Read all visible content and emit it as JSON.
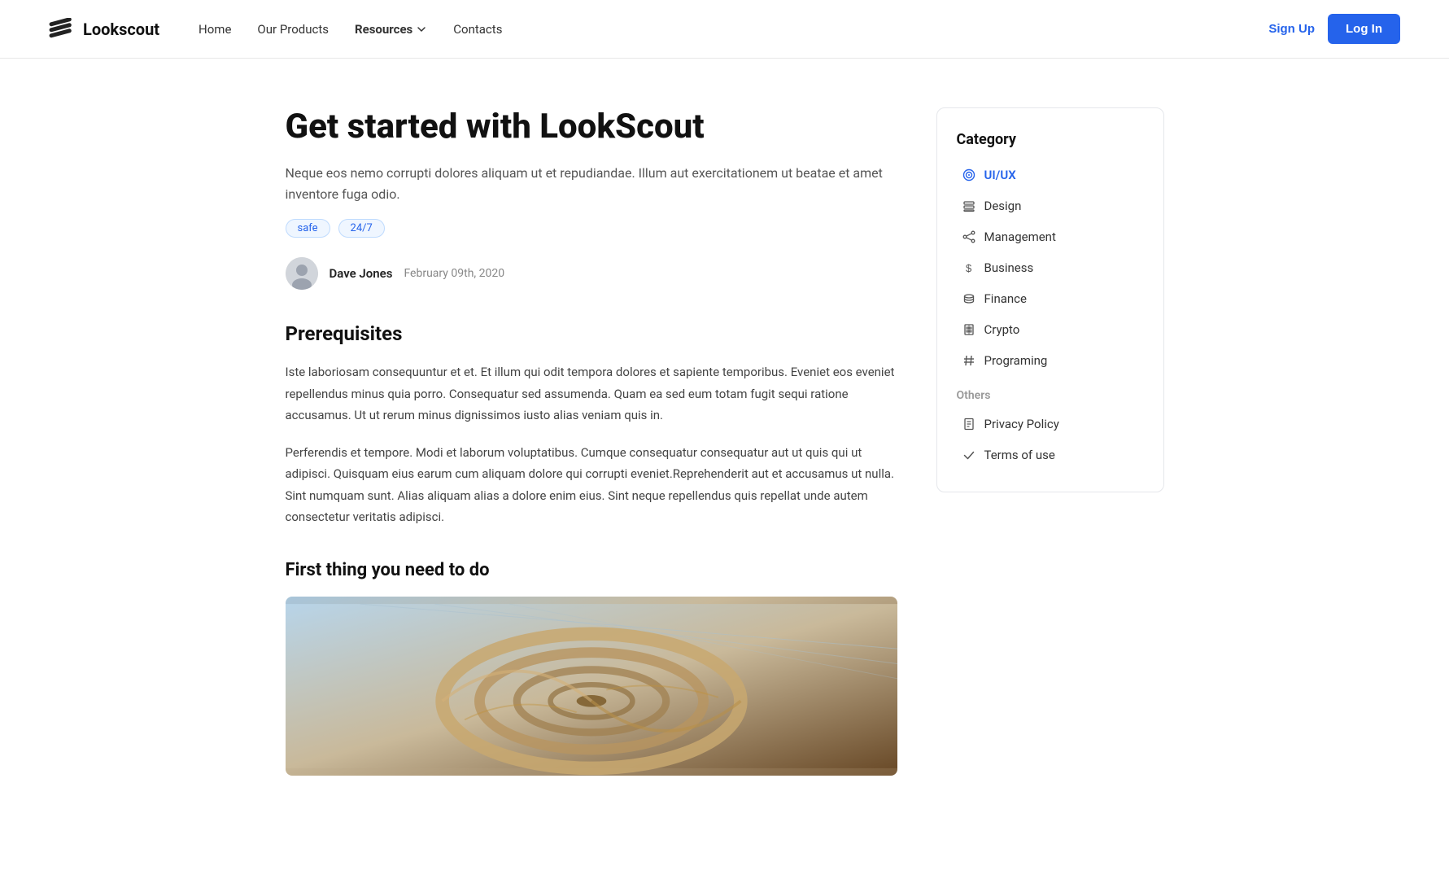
{
  "nav": {
    "logo_text": "Lookscout",
    "links": [
      {
        "label": "Home",
        "active": false
      },
      {
        "label": "Our Products",
        "active": false
      },
      {
        "label": "Resources",
        "active": true,
        "has_dropdown": true
      },
      {
        "label": "Contacts",
        "active": false
      }
    ],
    "signup_label": "Sign Up",
    "login_label": "Log In"
  },
  "article": {
    "title": "Get started with LookScout",
    "subtitle": "Neque eos nemo corrupti dolores aliquam ut et repudiandae. Illum aut exercitationem ut beatae et amet inventore fuga odio.",
    "tags": [
      "safe",
      "24/7"
    ],
    "author_name": "Dave Jones",
    "date": "February 09th, 2020",
    "prerequisites_heading": "Prerequisites",
    "prerequisites_body1": "Iste laboriosam consequuntur et et. Et illum qui odit tempora dolores et sapiente temporibus. Eveniet eos eveniet repellendus minus quia porro. Consequatur sed assumenda. Quam ea sed eum totam fugit sequi ratione accusamus. Ut ut rerum minus dignissimos iusto alias veniam quis in.",
    "prerequisites_body2": "Perferendis et tempore. Modi et laborum voluptatibus. Cumque consequatur consequatur aut ut quis qui ut adipisci. Quisquam eius earum cum aliquam dolore qui corrupti eveniet.Reprehenderit aut et accusamus ut nulla. Sint numquam sunt. Alias aliquam alias a dolore enim eius. Sint neque repellendus quis repellat unde autem consectetur veritatis adipisci.",
    "first_thing_heading": "First thing you need to do"
  },
  "sidebar": {
    "category_title": "Category",
    "items": [
      {
        "label": "UI/UX",
        "active": true,
        "icon": "target"
      },
      {
        "label": "Design",
        "icon": "layers"
      },
      {
        "label": "Management",
        "icon": "share"
      },
      {
        "label": "Business",
        "icon": "dollar"
      },
      {
        "label": "Finance",
        "icon": "stack"
      },
      {
        "label": "Crypto",
        "icon": "building"
      },
      {
        "label": "Programing",
        "icon": "hash"
      }
    ],
    "others_title": "Others",
    "other_items": [
      {
        "label": "Privacy Policy",
        "icon": "doc"
      },
      {
        "label": "Terms of use",
        "icon": "check"
      }
    ]
  }
}
